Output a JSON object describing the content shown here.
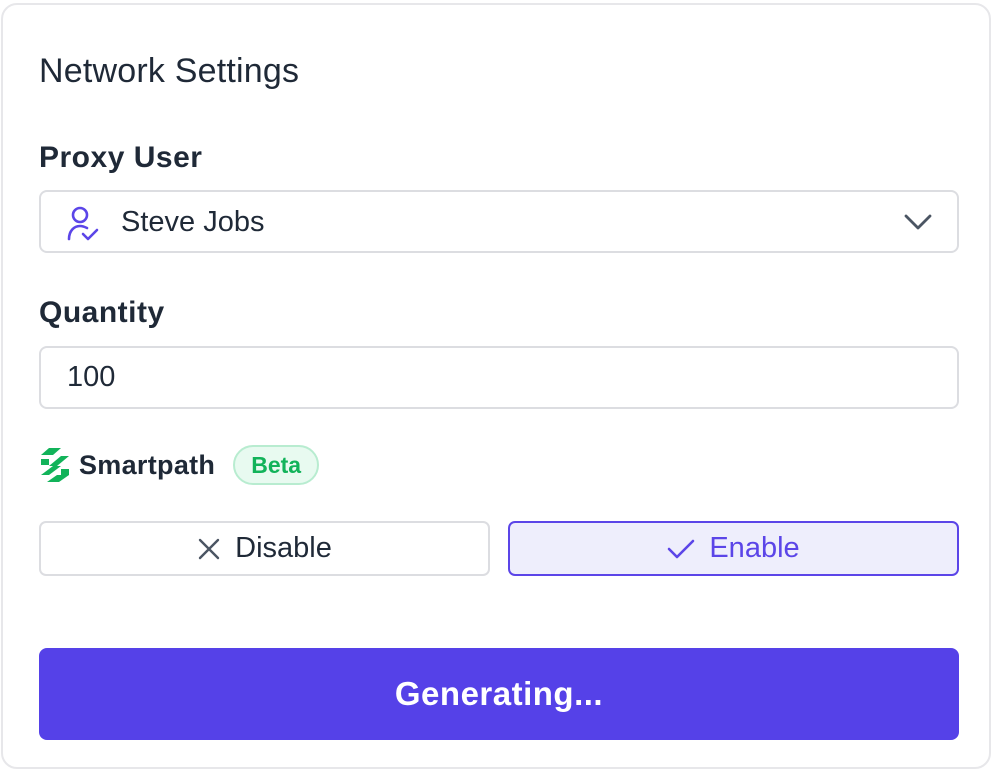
{
  "panel": {
    "title": "Network Settings"
  },
  "proxy_user": {
    "label": "Proxy User",
    "selected_value": "Steve Jobs",
    "icon": "user-check-icon"
  },
  "quantity": {
    "label": "Quantity",
    "value": "100"
  },
  "smartpath": {
    "name": "Smartpath",
    "badge": "Beta",
    "options": [
      {
        "label": "Disable",
        "icon": "close-icon",
        "selected": false
      },
      {
        "label": "Enable",
        "icon": "check-icon",
        "selected": true
      }
    ]
  },
  "primary_button": {
    "label": "Generating..."
  },
  "colors": {
    "accent": "#5541e8",
    "badge_text": "#12b35a",
    "badge_bg": "#e8faf0",
    "enable_bg": "#eeeefc"
  }
}
